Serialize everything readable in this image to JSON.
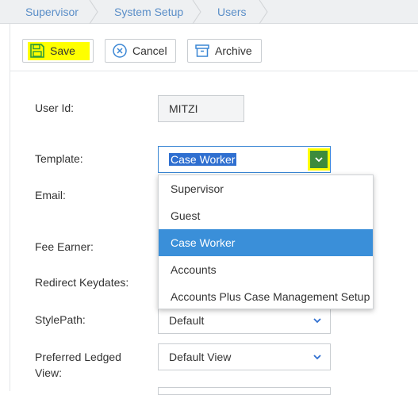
{
  "breadcrumb": [
    "Supervisor",
    "System Setup",
    "Users"
  ],
  "toolbar": {
    "save_label": "Save",
    "cancel_label": "Cancel",
    "archive_label": "Archive"
  },
  "form": {
    "user_id_label": "User Id:",
    "user_id_value": "MITZI",
    "template_label": "Template:",
    "template_value": "Case Worker",
    "email_label": "Email:",
    "fee_earner_label": "Fee Earner:",
    "redirect_keydates_label": "Redirect Keydates:",
    "stylepath_label": "StylePath:",
    "stylepath_value": "Default",
    "preferred_ledged_view_label_line1": "Preferred Ledged",
    "preferred_ledged_view_label_line2": "View:",
    "preferred_ledged_view_value": "Default View"
  },
  "template_options": [
    "Supervisor",
    "Guest",
    "Case Worker",
    "Accounts",
    "Accounts Plus Case Management Setup"
  ],
  "template_selected_index": 2,
  "colors": {
    "link": "#5a8ec8",
    "highlight": "#ffff00",
    "selection": "#3a8fd9",
    "chevron": "#2f6fd0"
  }
}
